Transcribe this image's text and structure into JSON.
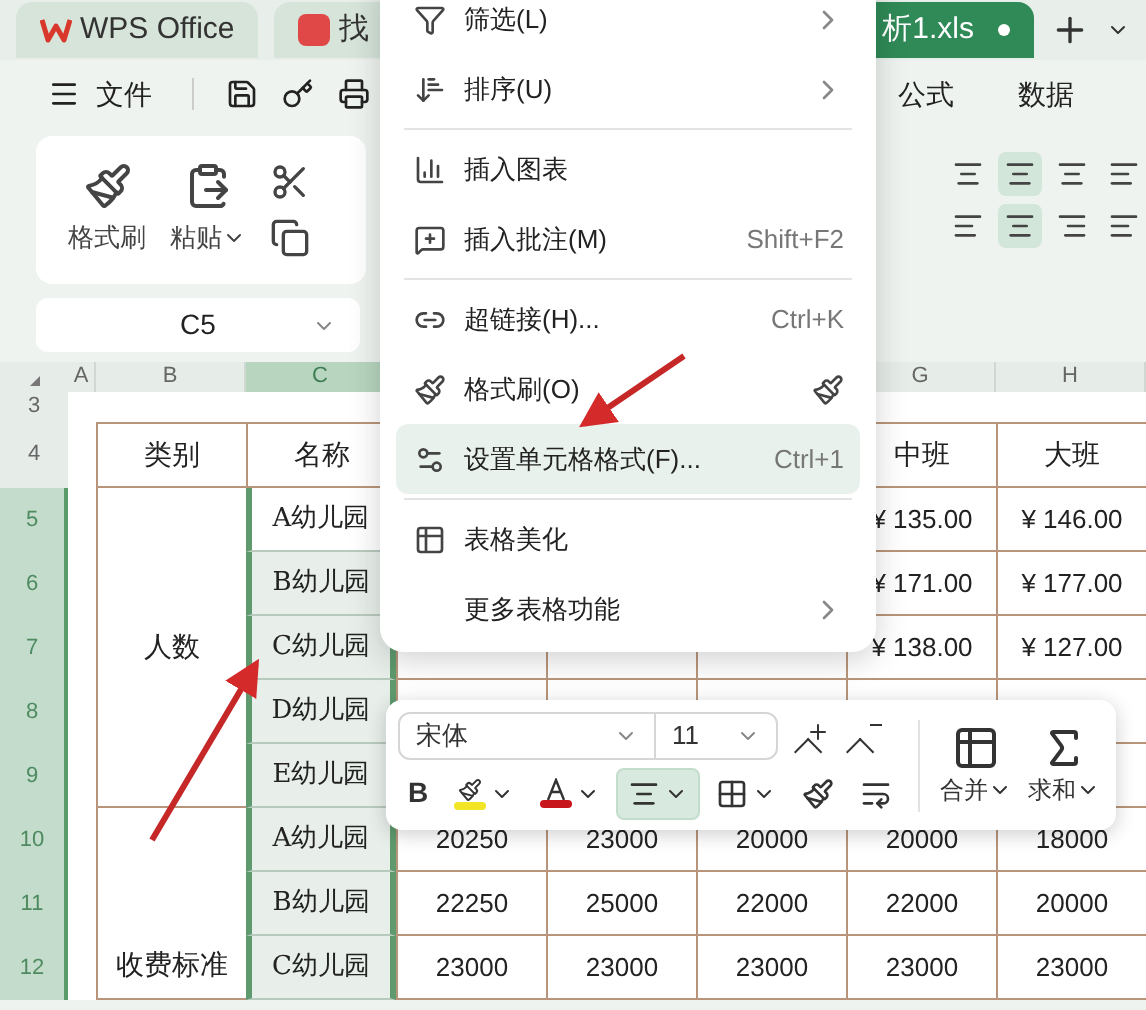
{
  "tabs": [
    {
      "label": "WPS Office",
      "kind": "home",
      "selected": false
    },
    {
      "label": "找",
      "kind": "doc",
      "selected": false
    },
    {
      "label": "析1.xls",
      "kind": "sheet",
      "selected": true
    }
  ],
  "menubar": {
    "file": "文件",
    "tabs": [
      "公式",
      "数据"
    ]
  },
  "ribbon": {
    "buttons": [
      {
        "label": "格式刷",
        "kind": "painter"
      },
      {
        "label": "粘贴",
        "kind": "paste"
      }
    ],
    "alignment": [
      {
        "selected": false
      },
      {
        "selected": true
      },
      {
        "selected": false
      },
      {
        "selected": false
      },
      {
        "selected": false
      },
      {
        "selected": true
      },
      {
        "selected": false
      },
      {
        "selected": false
      }
    ]
  },
  "name_box": "C5",
  "sheet": {
    "columns": [
      {
        "label": "A",
        "selected": false
      },
      {
        "label": "B",
        "selected": false
      },
      {
        "label": "C",
        "selected": true
      },
      {
        "label": "G",
        "selected": false
      },
      {
        "label": "H",
        "selected": false
      }
    ],
    "top_rows": [
      {
        "number": "3",
        "selected": false
      },
      {
        "number": "4",
        "selected": false,
        "category": "类别",
        "cells": [
          "名称",
          null,
          null,
          null,
          "中班",
          "大班"
        ]
      }
    ],
    "groups": [
      {
        "category": "人数",
        "rows": [
          {
            "number": "5",
            "selected": true,
            "active": true,
            "cells": [
              "A幼儿园",
              null,
              null,
              null,
              "¥ 135.00",
              "¥ 146.00"
            ]
          },
          {
            "number": "6",
            "selected": true,
            "active": false,
            "cells": [
              "B幼儿园",
              null,
              null,
              null,
              "¥ 171.00",
              "¥ 177.00"
            ]
          },
          {
            "number": "7",
            "selected": true,
            "active": false,
            "cells": [
              "C幼儿园",
              null,
              null,
              null,
              "¥ 138.00",
              "¥ 127.00"
            ]
          },
          {
            "number": "8",
            "selected": true,
            "active": false,
            "cells": [
              "D幼儿园",
              null,
              null,
              null,
              null,
              null
            ]
          },
          {
            "number": "9",
            "selected": true,
            "active": false,
            "cells": [
              "E幼儿园",
              null,
              null,
              null,
              null,
              null
            ]
          }
        ]
      },
      {
        "category": "收费标准",
        "rows": [
          {
            "number": "10",
            "selected": true,
            "active": false,
            "cells": [
              "A幼儿园",
              "20250",
              "23000",
              "20000",
              "20000",
              "18000"
            ]
          },
          {
            "number": "11",
            "selected": true,
            "active": false,
            "cells": [
              "B幼儿园",
              "22250",
              "25000",
              "22000",
              "22000",
              "20000"
            ]
          },
          {
            "number": "12",
            "selected": true,
            "active": false,
            "cells": [
              "C幼儿园",
              "23000",
              "23000",
              "23000",
              "23000",
              "23000"
            ]
          }
        ]
      }
    ]
  },
  "context_menu": [
    {
      "kind": "submenu",
      "label": "筛选(L)",
      "selected": false
    },
    {
      "kind": "submenu",
      "label": "排序(U)",
      "selected": false
    },
    {
      "kind": "divider"
    },
    {
      "kind": "plain",
      "label": "插入图表",
      "selected": false
    },
    {
      "kind": "shortcut",
      "label": "插入批注(M)",
      "shortcut": "Shift+F2",
      "selected": false
    },
    {
      "kind": "divider"
    },
    {
      "kind": "shortcut",
      "label": "超链接(H)...",
      "shortcut": "Ctrl+K",
      "selected": false
    },
    {
      "kind": "tool",
      "label": "格式刷(O)",
      "selected": false
    },
    {
      "kind": "shortcut",
      "label": "设置单元格格式(F)...",
      "shortcut": "Ctrl+1",
      "selected": true
    },
    {
      "kind": "divider"
    },
    {
      "kind": "plain",
      "label": "表格美化",
      "selected": false
    },
    {
      "kind": "submenu",
      "label": "更多表格功能",
      "selected": false
    }
  ],
  "mini_toolbar": {
    "font": "宋体",
    "size": "11",
    "merge": "合并",
    "sum": "求和",
    "buttons": [
      {
        "kind": "bold",
        "label": "B",
        "on": false
      },
      {
        "kind": "fill",
        "color": "#f2e526",
        "on": false
      },
      {
        "kind": "font_color",
        "color": "#c8161d",
        "on": false
      },
      {
        "kind": "align",
        "on": true
      },
      {
        "kind": "borders",
        "on": false
      },
      {
        "kind": "painter",
        "on": false
      },
      {
        "kind": "wrap",
        "on": false
      }
    ]
  }
}
